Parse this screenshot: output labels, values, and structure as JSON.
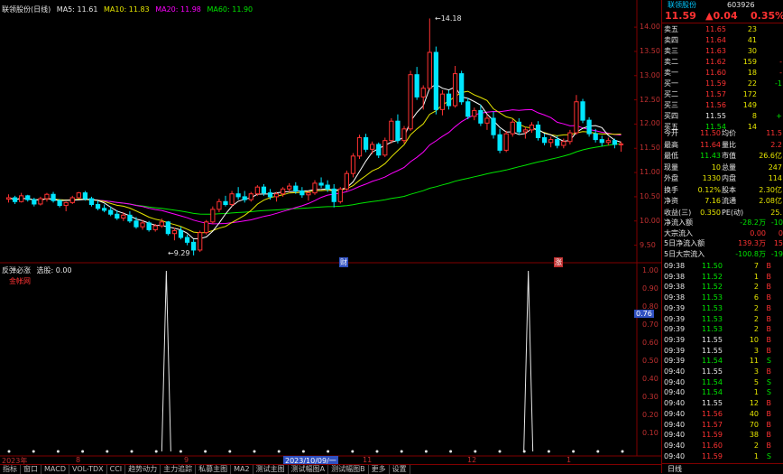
{
  "top_bar": {
    "label": "联领股份"
  },
  "main_legend": {
    "title": "联领股份(日线)",
    "ma5": "MA5: 11.61",
    "ma10": "MA10: 11.83",
    "ma20": "MA20: 11.98",
    "ma60": "MA60: 11.90"
  },
  "sub_legend": {
    "name": "反弹必涨",
    "value": "选股: 0.00",
    "sub": "金帐网"
  },
  "annotations": {
    "high": "14.18",
    "low": "9.29",
    "marker1": "财",
    "marker2": "涨"
  },
  "price_axis": [
    "14.00",
    "13.50",
    "13.00",
    "12.50",
    "12.00",
    "11.50",
    "11.00",
    "10.50",
    "10.00",
    "9.50"
  ],
  "ind_axis": [
    "1.00",
    "0.90",
    "0.80",
    "0.76",
    "0.70",
    "0.60",
    "0.50",
    "0.40",
    "0.30",
    "0.20",
    "0.10"
  ],
  "date_axis": [
    "2023年",
    "8",
    "9",
    "2023/10/09/一",
    "11",
    "12",
    "1"
  ],
  "tabs": [
    "指标",
    "窗口",
    "MACD",
    "VOL-TDX",
    "CCI",
    "趋势动力",
    "主力追踪",
    "私募主图",
    "MA2",
    "测试主图",
    "测试幅图A",
    "测试幅图B",
    "更多",
    "设置"
  ],
  "side": {
    "stock_name": "联领股份",
    "stock_code": "603926",
    "price": "11.59",
    "change": "▲0.04",
    "pct": "0.35%",
    "ask": [
      {
        "label": "卖五",
        "price": "11.65",
        "vol": "23",
        "extra": ""
      },
      {
        "label": "卖四",
        "price": "11.64",
        "vol": "41",
        "extra": ""
      },
      {
        "label": "卖三",
        "price": "11.63",
        "vol": "30",
        "extra": ""
      },
      {
        "label": "卖二",
        "price": "11.62",
        "vol": "159",
        "extra": "-"
      },
      {
        "label": "卖一",
        "price": "11.60",
        "vol": "18",
        "extra": "-"
      }
    ],
    "bid": [
      {
        "label": "买一",
        "price": "11.59",
        "vol": "22",
        "extra": "-1"
      },
      {
        "label": "买二",
        "price": "11.57",
        "vol": "172",
        "extra": ""
      },
      {
        "label": "买三",
        "price": "11.56",
        "vol": "149",
        "extra": ""
      },
      {
        "label": "买四",
        "price": "11.55",
        "vol": "8",
        "extra": "+"
      },
      {
        "label": "买五",
        "price": "11.54",
        "vol": "14",
        "extra": ""
      }
    ],
    "stats": [
      {
        "l1": "今开",
        "v1": "11.50",
        "l2": "均价",
        "v2": "11.5"
      },
      {
        "l1": "最高",
        "v1": "11.64",
        "l2": "量比",
        "v2": "2.2"
      },
      {
        "l1": "最低",
        "v1": "11.43",
        "l2": "市值",
        "v2": "26.6亿"
      },
      {
        "l1": "现量",
        "v1": "10",
        "l2": "总量",
        "v2": "247"
      },
      {
        "l1": "外盘",
        "v1": "1330",
        "l2": "内盘",
        "v2": "114"
      },
      {
        "l1": "换手",
        "v1": "0.12%",
        "l2": "股本",
        "v2": "2.30亿"
      },
      {
        "l1": "净资",
        "v1": "7.16",
        "l2": "流通",
        "v2": "2.08亿"
      },
      {
        "l1": "收益(三)",
        "v1": "0.350",
        "l2": "PE(动)",
        "v2": "25."
      }
    ],
    "flows": [
      {
        "label": "净流入额",
        "value": "-28.2万",
        "pct": "-10"
      },
      {
        "label": "大宗流入",
        "value": "0.00",
        "pct": "0"
      },
      {
        "label": "5日净流入额",
        "value": "139.3万",
        "pct": "15"
      },
      {
        "label": "5日大宗流入",
        "value": "-100.8万",
        "pct": "-19"
      }
    ],
    "ticks": [
      {
        "t": "09:38",
        "p": "11.50",
        "v": "7",
        "s": "B"
      },
      {
        "t": "09:38",
        "p": "11.52",
        "v": "1",
        "s": "B"
      },
      {
        "t": "09:38",
        "p": "11.52",
        "v": "2",
        "s": "B"
      },
      {
        "t": "09:38",
        "p": "11.53",
        "v": "6",
        "s": "B"
      },
      {
        "t": "09:39",
        "p": "11.53",
        "v": "2",
        "s": "B"
      },
      {
        "t": "09:39",
        "p": "11.53",
        "v": "2",
        "s": "B"
      },
      {
        "t": "09:39",
        "p": "11.53",
        "v": "2",
        "s": "B"
      },
      {
        "t": "09:39",
        "p": "11.55",
        "v": "10",
        "s": "B"
      },
      {
        "t": "09:39",
        "p": "11.55",
        "v": "3",
        "s": "B"
      },
      {
        "t": "09:39",
        "p": "11.54",
        "v": "11",
        "s": "S"
      },
      {
        "t": "09:40",
        "p": "11.55",
        "v": "3",
        "s": "B"
      },
      {
        "t": "09:40",
        "p": "11.54",
        "v": "5",
        "s": "S"
      },
      {
        "t": "09:40",
        "p": "11.54",
        "v": "1",
        "s": "S"
      },
      {
        "t": "09:40",
        "p": "11.55",
        "v": "12",
        "s": "B"
      },
      {
        "t": "09:40",
        "p": "11.56",
        "v": "40",
        "s": "B"
      },
      {
        "t": "09:40",
        "p": "11.57",
        "v": "70",
        "s": "B"
      },
      {
        "t": "09:40",
        "p": "11.59",
        "v": "38",
        "s": "B"
      },
      {
        "t": "09:40",
        "p": "11.60",
        "v": "2",
        "s": "B"
      },
      {
        "t": "09:40",
        "p": "11.59",
        "v": "1",
        "s": "S"
      }
    ],
    "bottom_tab": "日线"
  },
  "colors": {
    "up": "#ff3232",
    "down": "#00e6ff",
    "ma5": "#ffffff",
    "ma10": "#e6e600",
    "ma20": "#ff00ff",
    "ma60": "#00e600",
    "grid": "#800000"
  },
  "chart_data": {
    "type": "candlestick",
    "price_range": [
      9.25,
      14.3
    ],
    "candles": [
      [
        10.45,
        10.55,
        10.38,
        10.48
      ],
      [
        10.48,
        10.52,
        10.35,
        10.4
      ],
      [
        10.4,
        10.58,
        10.38,
        10.52
      ],
      [
        10.52,
        10.54,
        10.4,
        10.44
      ],
      [
        10.44,
        10.48,
        10.3,
        10.35
      ],
      [
        10.35,
        10.5,
        10.32,
        10.46
      ],
      [
        10.46,
        10.58,
        10.4,
        10.55
      ],
      [
        10.55,
        10.6,
        10.38,
        10.42
      ],
      [
        10.42,
        10.45,
        10.28,
        10.32
      ],
      [
        10.32,
        10.4,
        10.2,
        10.38
      ],
      [
        10.38,
        10.52,
        10.35,
        10.48
      ],
      [
        10.48,
        10.6,
        10.46,
        10.58
      ],
      [
        10.58,
        10.62,
        10.42,
        10.46
      ],
      [
        10.46,
        10.5,
        10.3,
        10.34
      ],
      [
        10.34,
        10.42,
        10.22,
        10.26
      ],
      [
        10.26,
        10.34,
        10.18,
        10.22
      ],
      [
        10.22,
        10.3,
        10.1,
        10.14
      ],
      [
        10.14,
        10.22,
        10.02,
        10.06
      ],
      [
        10.06,
        10.18,
        10.0,
        10.12
      ],
      [
        10.12,
        10.2,
        9.96,
        10.0
      ],
      [
        10.0,
        10.08,
        9.84,
        9.88
      ],
      [
        9.88,
        10.02,
        9.82,
        9.96
      ],
      [
        9.96,
        10.0,
        9.78,
        9.82
      ],
      [
        9.82,
        9.94,
        9.78,
        9.9
      ],
      [
        9.9,
        10.05,
        9.86,
        9.98
      ],
      [
        9.98,
        10.0,
        9.7,
        9.74
      ],
      [
        9.74,
        9.86,
        9.6,
        9.8
      ],
      [
        9.8,
        9.88,
        9.62,
        9.66
      ],
      [
        9.66,
        9.72,
        9.5,
        9.56
      ],
      [
        9.56,
        9.62,
        9.29,
        9.4
      ],
      [
        9.4,
        9.8,
        9.36,
        9.76
      ],
      [
        9.76,
        10.02,
        9.72,
        9.98
      ],
      [
        9.98,
        10.3,
        9.94,
        10.24
      ],
      [
        10.24,
        10.46,
        10.18,
        10.4
      ],
      [
        10.4,
        10.52,
        10.3,
        10.34
      ],
      [
        10.34,
        10.62,
        10.3,
        10.56
      ],
      [
        10.56,
        10.7,
        10.44,
        10.5
      ],
      [
        10.5,
        10.62,
        10.38,
        10.44
      ],
      [
        10.44,
        10.6,
        10.4,
        10.56
      ],
      [
        10.56,
        10.74,
        10.52,
        10.7
      ],
      [
        10.7,
        10.76,
        10.52,
        10.58
      ],
      [
        10.58,
        10.66,
        10.44,
        10.5
      ],
      [
        10.5,
        10.6,
        10.4,
        10.56
      ],
      [
        10.56,
        10.7,
        10.5,
        10.66
      ],
      [
        10.66,
        10.78,
        10.6,
        10.72
      ],
      [
        10.72,
        10.8,
        10.56,
        10.62
      ],
      [
        10.62,
        10.7,
        10.48,
        10.54
      ],
      [
        10.54,
        10.62,
        10.42,
        10.58
      ],
      [
        10.58,
        10.84,
        10.54,
        10.78
      ],
      [
        10.78,
        10.9,
        10.68,
        10.74
      ],
      [
        10.74,
        10.84,
        10.6,
        10.66
      ],
      [
        10.66,
        10.76,
        10.28,
        10.4
      ],
      [
        10.4,
        10.7,
        10.36,
        10.66
      ],
      [
        10.66,
        11.04,
        10.62,
        10.98
      ],
      [
        10.98,
        11.4,
        10.9,
        11.34
      ],
      [
        11.34,
        11.78,
        11.28,
        11.72
      ],
      [
        11.72,
        11.8,
        11.42,
        11.48
      ],
      [
        11.48,
        11.64,
        11.38,
        11.58
      ],
      [
        11.58,
        11.62,
        11.3,
        11.36
      ],
      [
        11.36,
        11.72,
        11.32,
        11.66
      ],
      [
        11.66,
        12.12,
        11.6,
        12.06
      ],
      [
        12.06,
        12.2,
        11.6,
        11.66
      ],
      [
        11.66,
        11.96,
        11.6,
        11.9
      ],
      [
        11.9,
        13.1,
        11.86,
        13.02
      ],
      [
        13.02,
        13.18,
        12.5,
        12.56
      ],
      [
        12.56,
        12.8,
        12.3,
        12.74
      ],
      [
        12.74,
        14.18,
        12.7,
        13.48
      ],
      [
        13.48,
        13.6,
        12.2,
        12.3
      ],
      [
        12.3,
        12.7,
        12.18,
        12.62
      ],
      [
        12.62,
        12.7,
        12.3,
        12.38
      ],
      [
        12.38,
        13.2,
        12.34,
        13.04
      ],
      [
        13.04,
        13.1,
        12.4,
        12.46
      ],
      [
        12.46,
        12.54,
        12.1,
        12.16
      ],
      [
        12.16,
        12.34,
        12.08,
        12.28
      ],
      [
        12.28,
        12.4,
        11.96,
        12.02
      ],
      [
        12.02,
        12.2,
        11.88,
        12.12
      ],
      [
        12.12,
        12.26,
        11.7,
        11.78
      ],
      [
        11.78,
        11.9,
        11.4,
        11.46
      ],
      [
        11.46,
        11.86,
        11.42,
        11.8
      ],
      [
        11.8,
        12.1,
        11.74,
        12.04
      ],
      [
        12.04,
        12.12,
        11.78,
        11.84
      ],
      [
        11.84,
        11.94,
        11.7,
        11.88
      ],
      [
        11.88,
        12.04,
        11.82,
        11.98
      ],
      [
        11.98,
        12.06,
        11.66,
        11.72
      ],
      [
        11.72,
        11.8,
        11.56,
        11.62
      ],
      [
        11.62,
        11.74,
        11.52,
        11.68
      ],
      [
        11.68,
        11.76,
        11.5,
        11.56
      ],
      [
        11.56,
        11.7,
        11.5,
        11.64
      ],
      [
        11.64,
        11.88,
        11.58,
        11.82
      ],
      [
        11.82,
        12.6,
        11.78,
        12.46
      ],
      [
        12.46,
        12.52,
        12.02,
        12.08
      ],
      [
        12.08,
        12.14,
        11.74,
        11.8
      ],
      [
        11.8,
        11.9,
        11.62,
        11.68
      ],
      [
        11.68,
        11.76,
        11.54,
        11.62
      ],
      [
        11.62,
        11.72,
        11.56,
        11.66
      ],
      [
        11.66,
        11.7,
        11.5,
        11.58
      ],
      [
        11.58,
        11.64,
        11.43,
        11.59
      ]
    ],
    "signal_peaks": [
      0.26,
      0.845
    ],
    "signal_dots": 26
  }
}
